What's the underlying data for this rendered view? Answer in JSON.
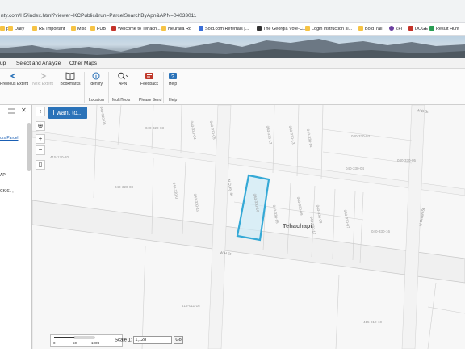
{
  "browser": {
    "url": "nty.com/H5/index.html?viewer=KCPublic&run=ParcelSearchByApn&APN=04033011",
    "bookmarks": [
      {
        "label": "p",
        "icon": "folder"
      },
      {
        "label": "Daily",
        "icon": "folder"
      },
      {
        "label": "RE Important",
        "icon": "folder"
      },
      {
        "label": "Misc",
        "icon": "folder"
      },
      {
        "label": "FUB",
        "icon": "folder"
      },
      {
        "label": "Welcome to Tehach...",
        "icon": "red"
      },
      {
        "label": "Neuralia Rd",
        "icon": "folder"
      },
      {
        "label": "Sold.com Referrals |...",
        "icon": "blue"
      },
      {
        "label": "The Georgia Vote-C...",
        "icon": "dark"
      },
      {
        "label": "Login instruction si...",
        "icon": "folder"
      },
      {
        "label": "BoldTrail",
        "icon": "folder"
      },
      {
        "label": "ZFi",
        "icon": "pu"
      },
      {
        "label": "DOGE",
        "icon": "red"
      },
      {
        "label": "Result Hunt",
        "icon": "gr"
      }
    ]
  },
  "menu": {
    "tabs": [
      "up",
      "Select and Analyze",
      "Other Maps"
    ]
  },
  "ribbon": {
    "tools": [
      {
        "label": "Previous Extent"
      },
      {
        "label": "Next Extent"
      },
      {
        "label": "Bookmarks"
      },
      {
        "label": "Identify"
      },
      {
        "label": "APN"
      },
      {
        "label": "Feedback"
      },
      {
        "label": "Help"
      }
    ],
    "groups": [
      "Location",
      "MultiTools",
      "Please Send",
      "Help"
    ]
  },
  "left_panel": {
    "link": "ors Parcel",
    "line1": "API",
    "line2": "CK 61 ,"
  },
  "map": {
    "i_want_label": "I want to...",
    "place_label": "Tehachapi",
    "street_labels": [
      "W H St",
      "N Curry St",
      "N Green St",
      "W G St"
    ],
    "parcel_labels": [
      "040-310-05",
      "040-320-03",
      "040-320-04",
      "040-320-05",
      "040-330-12",
      "040-330-13",
      "040-330-14",
      "040-330-03",
      "040-330-04",
      "040-330-05",
      "415-170-20",
      "040-320-08",
      "040-320-07",
      "040-330-11",
      "040-330-10",
      "040-330-15",
      "040-330-09",
      "040-330-08",
      "040-330-07",
      "040-330-16",
      "040-330-17",
      "415-011-16",
      "415-012-10"
    ],
    "selected_parcel": "040-330-11"
  },
  "scale": {
    "ticks": [
      "0",
      "50",
      "100ft"
    ],
    "label": "Scale 1:",
    "value": "1,128",
    "go_label": "Go"
  }
}
